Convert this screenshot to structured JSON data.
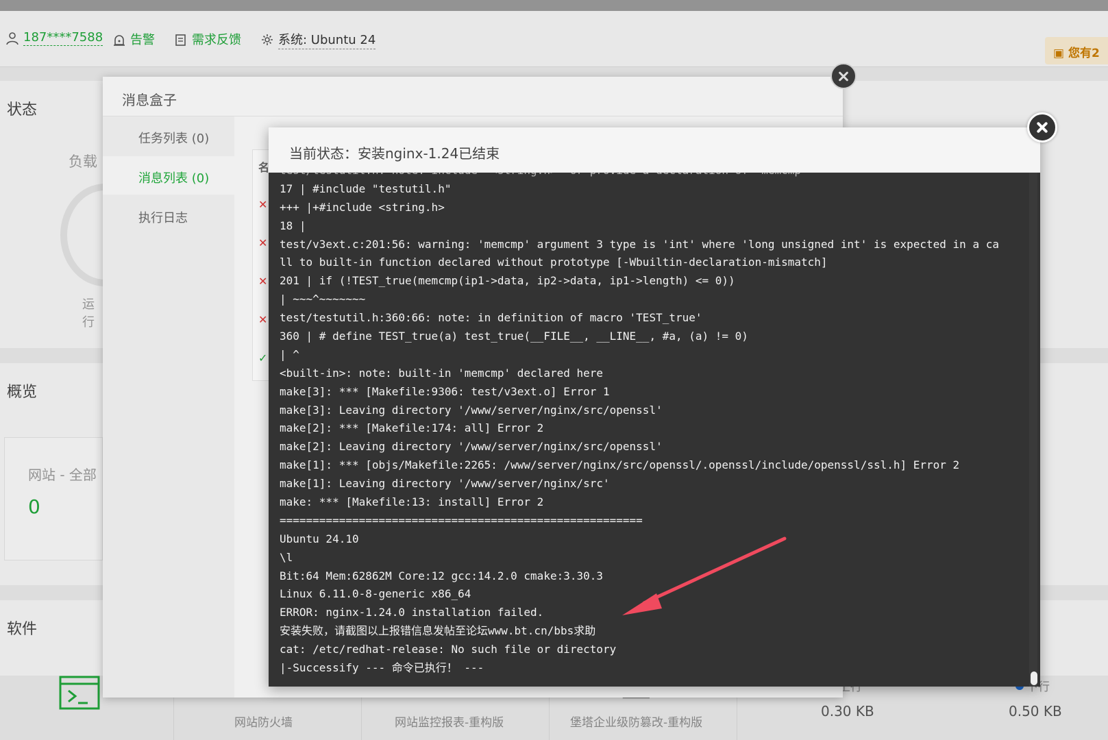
{
  "header": {
    "user": "187****7588",
    "alert": "告警",
    "feedback": "需求反馈",
    "system": "系统:  Ubuntu 24",
    "notice": "您有2"
  },
  "sections": {
    "status": "状态",
    "load": "负载",
    "running": "运行",
    "overview": "概览",
    "websites": "网站 - 全部",
    "websites_count": "0",
    "software": "软件"
  },
  "message_box": {
    "title": "消息盒子",
    "tabs": [
      {
        "label": "任务列表 (0)"
      },
      {
        "label": "消息列表 (0)"
      },
      {
        "label": "执行日志"
      }
    ],
    "list_header": "名"
  },
  "terminal": {
    "title": "当前状态：安装nginx-1.24已结束",
    "lines": [
      "test/testutil.h: note: include '<string.h>' or provide a declaration of 'memcmp'",
      "17 | #include \"testutil.h\"",
      "+++ |+#include <string.h>",
      "18 |",
      "test/v3ext.c:201:56: warning: 'memcmp' argument 3 type is 'int' where 'long unsigned int' is expected in a ca",
      "ll to built-in function declared without prototype [-Wbuiltin-declaration-mismatch]",
      "201 | if (!TEST_true(memcmp(ip1->data, ip2->data, ip1->length) <= 0))",
      "| ~~~^~~~~~~~",
      "test/testutil.h:360:66: note: in definition of macro 'TEST_true'",
      "360 | # define TEST_true(a) test_true(__FILE__, __LINE__, #a, (a) != 0)",
      "| ^",
      "<built-in>: note: built-in 'memcmp' declared here",
      "make[3]: *** [Makefile:9306: test/v3ext.o] Error 1",
      "make[3]: Leaving directory '/www/server/nginx/src/openssl'",
      "make[2]: *** [Makefile:174: all] Error 2",
      "make[2]: Leaving directory '/www/server/nginx/src/openssl'",
      "make[1]: *** [objs/Makefile:2265: /www/server/nginx/src/openssl/.openssl/include/openssl/ssl.h] Error 2",
      "make[1]: Leaving directory '/www/server/nginx/src'",
      "make: *** [Makefile:13: install] Error 2",
      "=======================================================",
      "Ubuntu 24.10",
      "\\l",
      "Bit:64 Mem:62862M Core:12 gcc:14.2.0 cmake:3.30.3",
      "Linux 6.11.0-8-generic x86_64",
      "ERROR: nginx-1.24.0 installation failed.",
      "安装失败，请截图以上报错信息发帖至论坛www.bt.cn/bbs求助",
      "cat: /etc/redhat-release: No such file or directory",
      "|-Successify --- 命令已执行！ ---"
    ]
  },
  "bottom": {
    "firewall": "网站防火墙",
    "monitor": "网站监控报表-重构版",
    "tamper": "堡塔企业级防篡改-重构版",
    "upstream_label": "上行",
    "downstream_label": "下行",
    "upstream_value": "0.30 KB",
    "downstream_value": "0.50 KB"
  },
  "colors": {
    "accent": "#20a53a",
    "terminal_bg": "#333333",
    "arrow": "#f04a5e",
    "upstream_dot": "#f5a623",
    "downstream_dot": "#1e6fd9"
  }
}
